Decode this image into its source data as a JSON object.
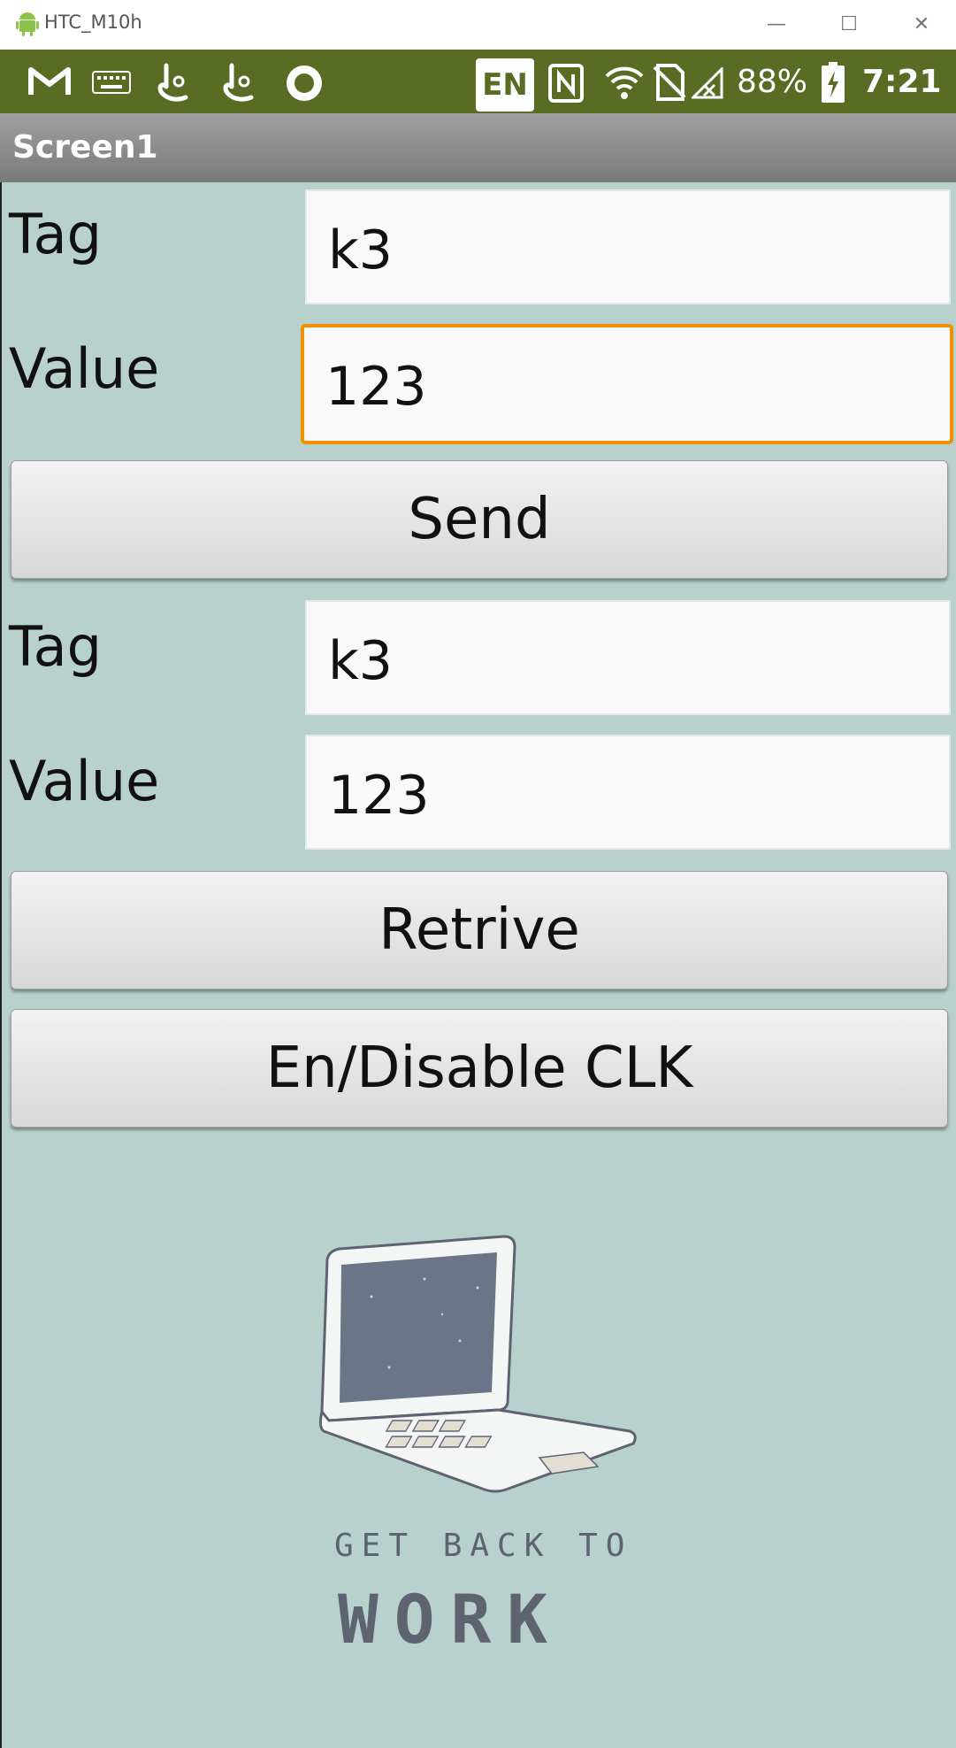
{
  "window": {
    "title": "HTC_M10h"
  },
  "status_bar": {
    "ime": "EN",
    "battery": "88%",
    "time": "7:21"
  },
  "screen": {
    "title": "Screen1"
  },
  "form": {
    "tag_label_1": "Tag",
    "tag_value_1": "k3",
    "value_label_1": "Value",
    "value_value_1": "123",
    "send_button": "Send",
    "tag_label_2": "Tag",
    "tag_value_2": "k3",
    "value_label_2": "Value",
    "value_value_2": "123",
    "retrieve_button": "Retrive",
    "clk_button": "En/Disable CLK"
  },
  "illustration": {
    "line1": "GET BACK TO",
    "line2": "WORK"
  },
  "colors": {
    "status_bar": "#5a6b24",
    "background": "#b8d1cc",
    "focus_border": "#f29000"
  }
}
